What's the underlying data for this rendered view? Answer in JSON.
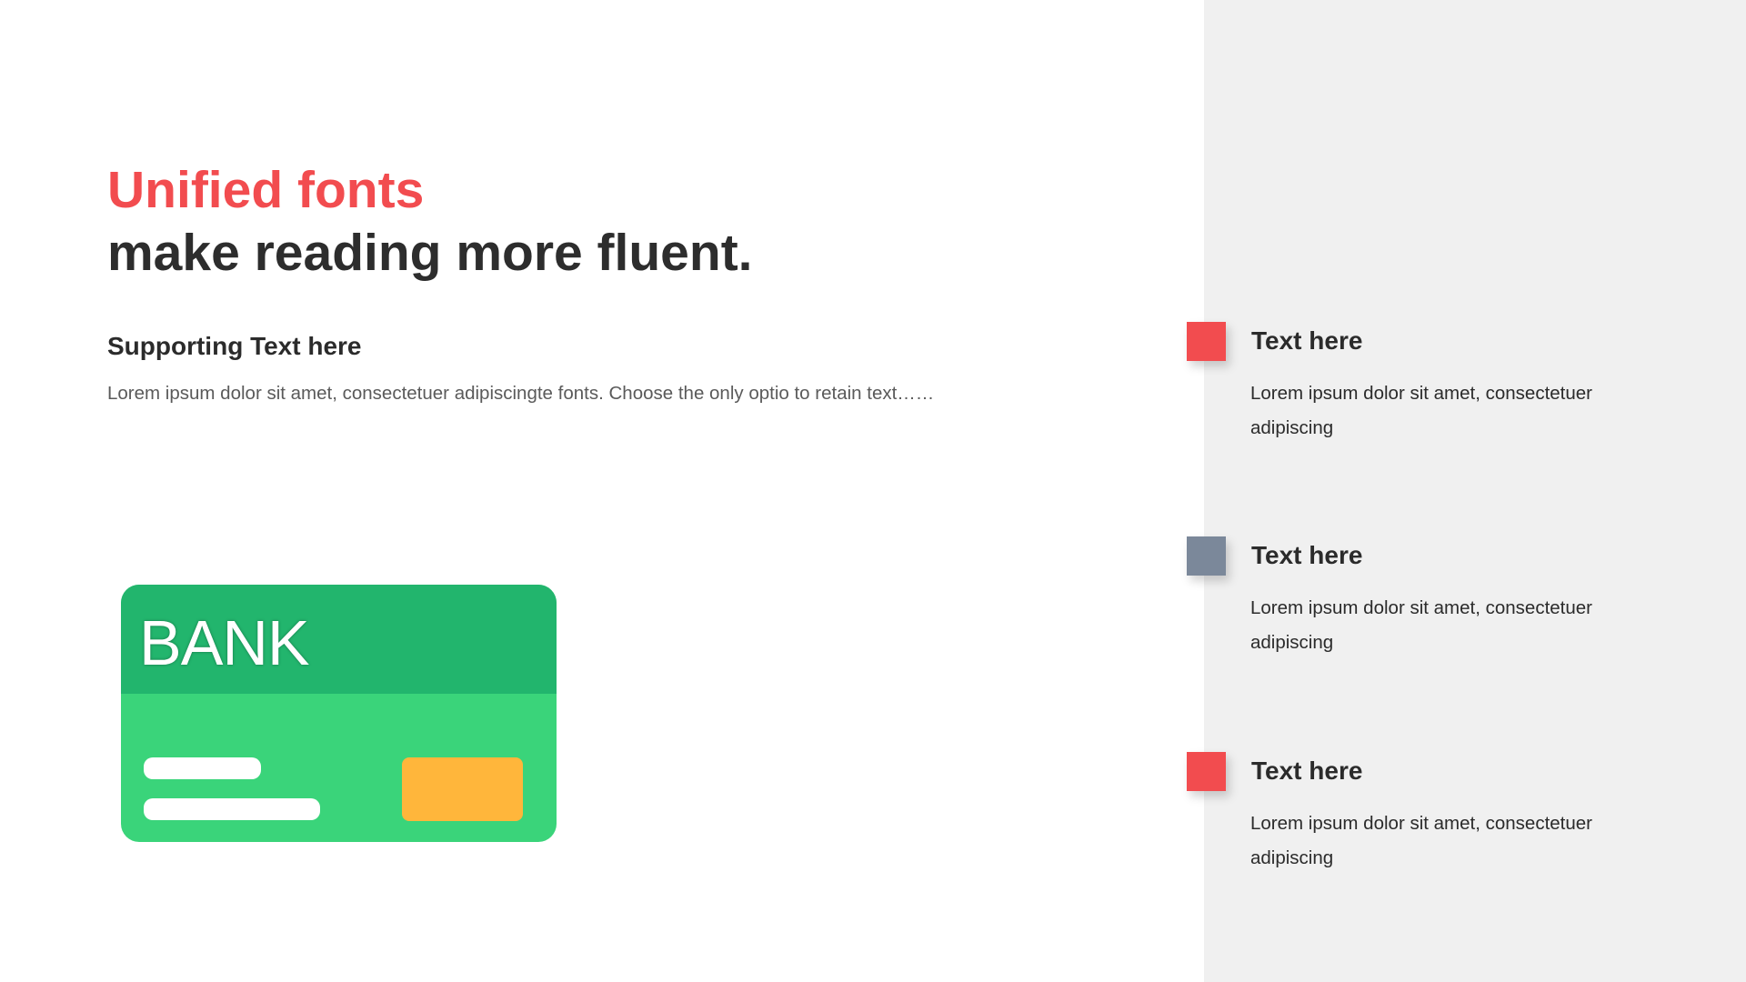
{
  "headline": {
    "accent": "Unified fonts",
    "main": "make reading more fluent."
  },
  "supporting": {
    "title": "Supporting Text here",
    "body": "Lorem ipsum dolor sit amet, consectetuer adipiscingte fonts. Choose the only optio to retain text……"
  },
  "card": {
    "label": "BANK",
    "colors": {
      "top": "#22b56d",
      "body": "#3ad47a",
      "chip": "#ffb63b"
    }
  },
  "features": [
    {
      "title": "Text here",
      "body": "Lorem ipsum dolor sit amet, consectetuer adipiscing",
      "color": "#f24c4f"
    },
    {
      "title": "Text here",
      "body": "Lorem ipsum dolor sit amet, consectetuer adipiscing",
      "color": "#7b889a"
    },
    {
      "title": "Text here",
      "body": "Lorem ipsum dolor sit amet, consectetuer adipiscing",
      "color": "#f24c4f"
    }
  ],
  "colors": {
    "accent": "#f24c4f",
    "panel": "#f0f0f0",
    "text": "#2d2d2d"
  }
}
